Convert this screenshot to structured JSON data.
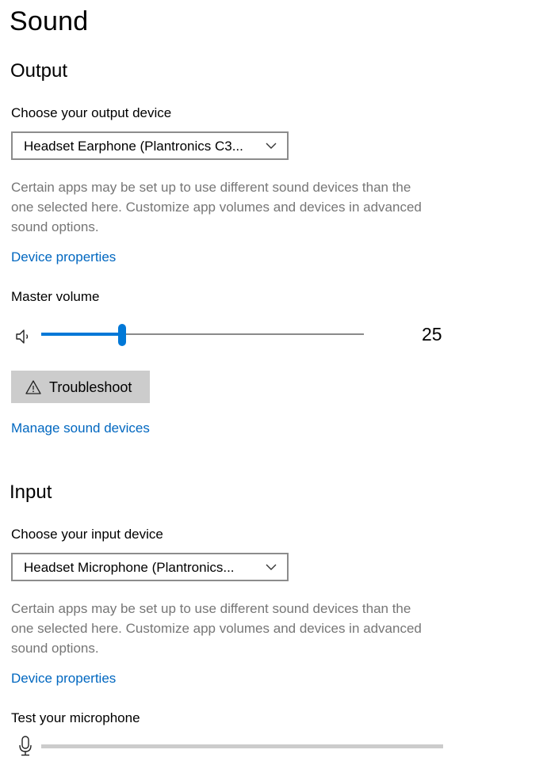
{
  "page": {
    "title": "Sound"
  },
  "output": {
    "heading": "Output",
    "choose_label": "Choose your output device",
    "device_value": "Headset Earphone (Plantronics C3...",
    "description_line1": "Certain apps may be set up to use different sound devices than the",
    "description_line2": "one selected here. Customize app volumes and devices in advanced",
    "description_line3": "sound options.",
    "device_properties_link": "Device properties",
    "master_volume_label": "Master volume",
    "volume": 25,
    "volume_display": "25",
    "troubleshoot_label": "Troubleshoot",
    "manage_link": "Manage sound devices"
  },
  "input": {
    "heading": "Input",
    "choose_label": "Choose your input device",
    "device_value": "Headset Microphone (Plantronics...",
    "description_line1": "Certain apps may be set up to use different sound devices than the",
    "description_line2": "one selected here. Customize app volumes and devices in advanced",
    "description_line3": "sound options.",
    "device_properties_link": "Device properties",
    "test_mic_label": "Test your microphone",
    "mic_level": 0
  },
  "icons": {
    "dropdown": "chevron-down-icon",
    "speaker": "speaker-icon",
    "warning": "warning-icon",
    "microphone": "microphone-icon"
  },
  "colors": {
    "accent": "#0078d7",
    "link": "#0067c0",
    "secondary_text": "#767676",
    "button_bg": "#cccccc"
  }
}
